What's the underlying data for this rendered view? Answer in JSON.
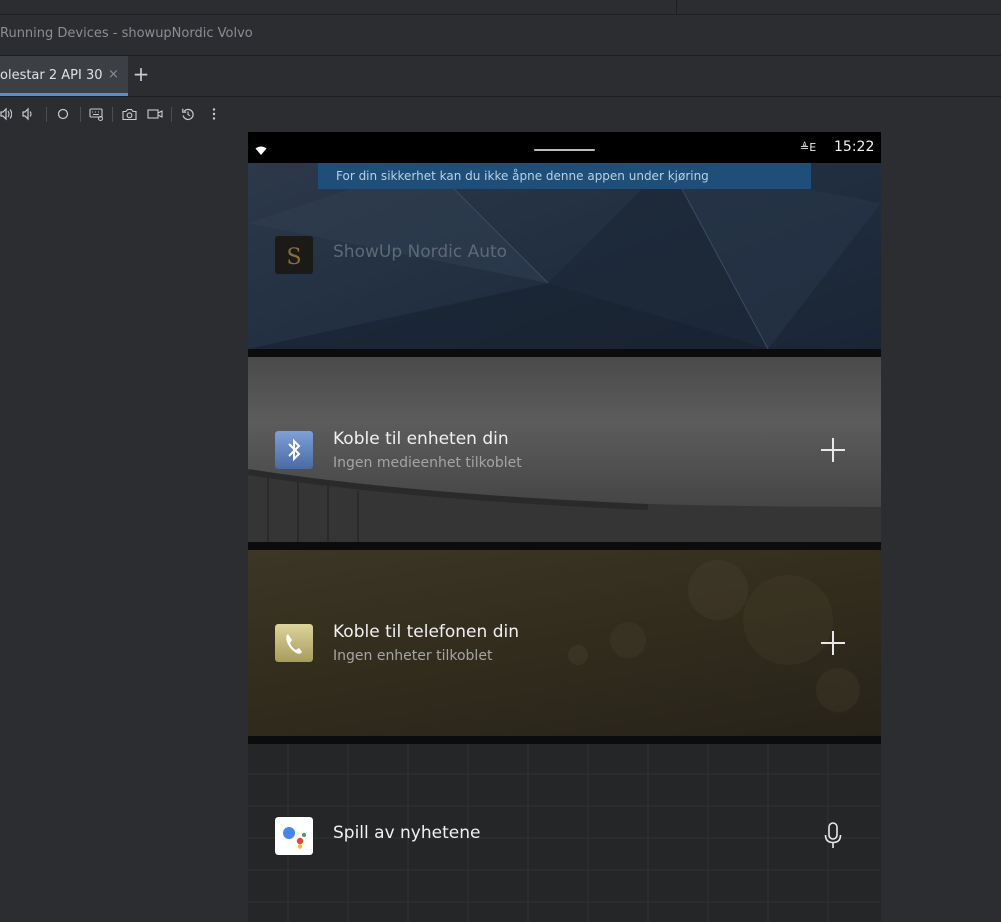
{
  "window": {
    "title": "Running Devices - showupNordic Volvo"
  },
  "tabs": [
    {
      "label": "olestar 2 API 30",
      "close": "×"
    }
  ],
  "add_tab": "+",
  "toolbar": {
    "icons": [
      "volume-up-icon",
      "volume-down-icon",
      "power-icon",
      "keyboard-icon",
      "camera-icon",
      "video-icon",
      "rotate-icon",
      "more-icon"
    ]
  },
  "device": {
    "status_bar": {
      "time": "15:22",
      "signal": "≜E"
    },
    "banner": "For din sikkerhet kan du ikke åpne denne appen under kjøring",
    "cards": [
      {
        "title": "ShowUp Nordic Auto",
        "icon": "showup-app-icon"
      },
      {
        "title": "Koble til enheten din",
        "subtitle": "Ingen medieenhet tilkoblet",
        "icon": "bluetooth-icon",
        "action": "add-icon"
      },
      {
        "title": "Koble til telefonen din",
        "subtitle": "Ingen enheter tilkoblet",
        "icon": "phone-icon",
        "action": "add-icon"
      },
      {
        "title": "Spill av nyhetene",
        "icon": "google-assistant-icon",
        "action": "microphone-icon"
      }
    ]
  },
  "colors": {
    "ide_bg": "#2b2d30",
    "tab_active": "#3c3f44",
    "accent": "#4e8fe6",
    "banner_bg": "#1f4f79",
    "bluetooth_tile": "#5b7fb8",
    "phone_tile": "#c9bf7e"
  }
}
